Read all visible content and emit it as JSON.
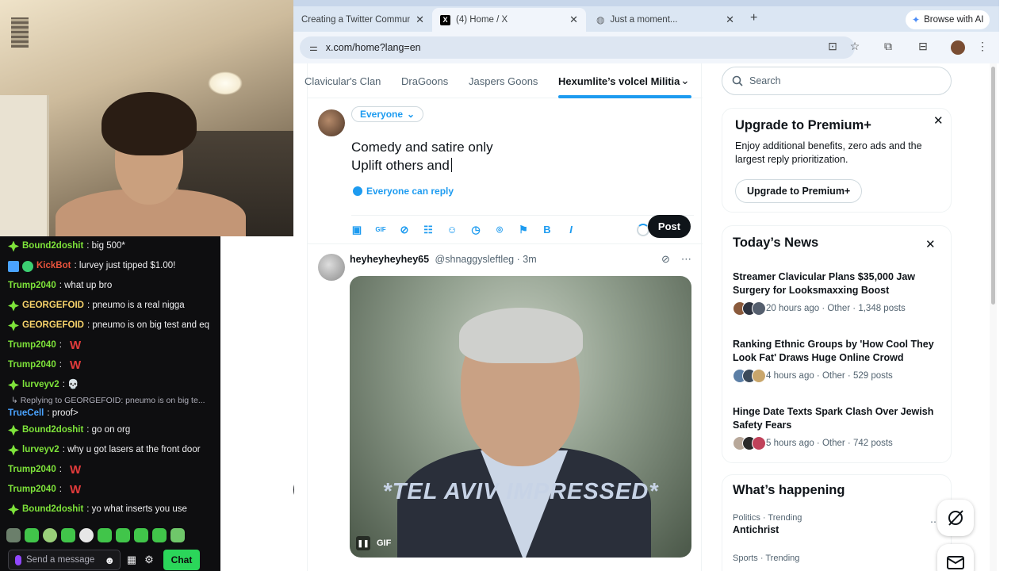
{
  "chat": {
    "messages": [
      {
        "user": "Bound2doshit",
        "text": ": big 500*",
        "color": "#7ee33a",
        "badge": "diamond"
      },
      {
        "user": "KickBot",
        "text": ": lurvey just tipped $1.00!",
        "color": "#e9533c",
        "badge": "bot"
      },
      {
        "user": "Trump2040",
        "text": ": what up bro",
        "color": "#7ee33a",
        "badge": "none"
      },
      {
        "user": "GEORGEFOID",
        "text": ": pneumo is a real nigga",
        "color": "#f7d36b",
        "badge": "diamond"
      },
      {
        "user": "GEORGEFOID",
        "text": ": pneumo is on big test and eq",
        "color": "#f7d36b",
        "badge": "diamond"
      },
      {
        "user": "Trump2040",
        "text": ":",
        "color": "#7ee33a",
        "badge": "none",
        "emote": "W"
      },
      {
        "user": "Trump2040",
        "text": ":",
        "color": "#7ee33a",
        "badge": "none",
        "emote": "W"
      },
      {
        "user": "lurveyv2",
        "text": ": 💀",
        "color": "#7ee33a",
        "badge": "diamond"
      }
    ],
    "reply_context": "Replying to GEORGEFOID: pneumo is on big te...",
    "messages2": [
      {
        "user": "TrueCell",
        "text": ": proof>",
        "color": "#4aa3ff",
        "badge": "none"
      },
      {
        "user": "Bound2doshit",
        "text": ": go on org",
        "color": "#7ee33a",
        "badge": "diamond"
      },
      {
        "user": "lurveyv2",
        "text": ": why u got lasers at the front door",
        "color": "#7ee33a",
        "badge": "diamond"
      },
      {
        "user": "Trump2040",
        "text": ":",
        "color": "#7ee33a",
        "badge": "none",
        "emote": "W"
      },
      {
        "user": "Trump2040",
        "text": ":",
        "color": "#7ee33a",
        "badge": "none",
        "emote": "W"
      },
      {
        "user": "Bound2doshit",
        "text": ": yo what inserts you use",
        "color": "#7ee33a",
        "badge": "diamond"
      }
    ],
    "input_placeholder": "Send a message",
    "chat_button": "Chat"
  },
  "browser": {
    "tabs": [
      {
        "title": "Creating a Twitter Community"
      },
      {
        "title": "(4) Home / X"
      },
      {
        "title": "Just a moment..."
      }
    ],
    "browse_ai": "Browse with AI",
    "url": "x.com/home?lang=en"
  },
  "x": {
    "community_tabs": [
      "Clavicular's Clan",
      "DraGoons",
      "Jaspers Goons",
      "Hexumlite’s volcel Militia"
    ],
    "composer": {
      "audience": "Everyone",
      "line1": "Comedy and satire only",
      "line2": "Uplift others and",
      "reply_setting": "Everyone can reply",
      "post_button": "Post"
    },
    "tweet": {
      "name": "heyheyheyhey65",
      "handle": "@shnaggysleftleg",
      "dot": "·",
      "time": "3m",
      "gif_caption": "*TEL AVIV IMPRESSED*",
      "gif_label": "GIF"
    },
    "search_placeholder": "Search",
    "premium": {
      "title": "Upgrade to Premium+",
      "body": "Enjoy additional benefits, zero ads and the largest reply prioritization.",
      "button": "Upgrade to Premium+"
    },
    "news": {
      "title": "Today’s News",
      "items": [
        {
          "headline": "Streamer Clavicular Plans $35,000 Jaw Surgery for Looksmaxxing Boost",
          "meta": "20 hours ago · Other · 1,348 posts"
        },
        {
          "headline": "Ranking Ethnic Groups by 'How Cool They Look Fat' Draws Huge Online Crowd",
          "meta": "4 hours ago · Other · 529 posts"
        },
        {
          "headline": "Hinge Date Texts Spark Clash Over Jewish Safety Fears",
          "meta": "5 hours ago · Other · 742 posts"
        }
      ]
    },
    "happening": {
      "title": "What’s happening",
      "trends": [
        {
          "category": "Politics · Trending",
          "topic": "Antichrist"
        },
        {
          "category": "Sports · Trending",
          "topic": ""
        }
      ]
    }
  }
}
